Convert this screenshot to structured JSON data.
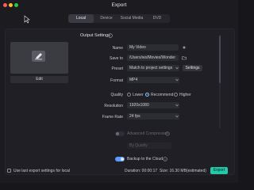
{
  "window": {
    "title": "Export"
  },
  "tabs": [
    {
      "label": "Local",
      "active": true
    },
    {
      "label": "Device",
      "active": false
    },
    {
      "label": "Social Media",
      "active": false
    },
    {
      "label": "DVD",
      "active": false
    }
  ],
  "preview": {
    "edit_label": "Edit"
  },
  "output": {
    "section_title": "Output Settings",
    "name_label": "Name",
    "name_value": "My Video",
    "save_label": "Save to",
    "save_value": "/Users/ws/Movies/Wonder",
    "preset_label": "Preset",
    "preset_value": "Match to project settings",
    "settings_button": "Settings",
    "format_label": "Format",
    "format_value": "MP4",
    "quality_label": "Quality",
    "quality_options": [
      "Lower",
      "Recommend",
      "Higher"
    ],
    "quality_selected": "Recommend",
    "resolution_label": "Resolution",
    "resolution_value": "1920x1080",
    "framerate_label": "Frame Rate",
    "framerate_value": "24 fps",
    "advanced_label": "Advanced Compression",
    "advanced_mode_value": "By Quality",
    "backup_label": "Backup to the Cloud"
  },
  "footer": {
    "checkbox_label": "Use last export settings for local",
    "duration_label": "Duration: 00:00:17",
    "size_label": "Size: 16.30 MB(estimated)",
    "export_label": "Export"
  },
  "colors": {
    "accent": "#22c9a8",
    "toggle_on": "#5b9bff"
  }
}
